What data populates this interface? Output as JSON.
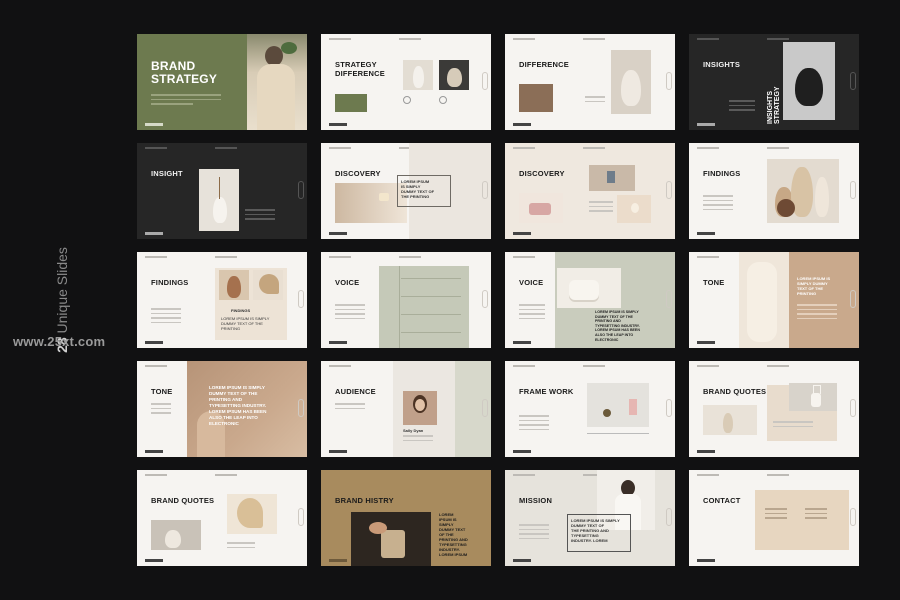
{
  "side": {
    "count": "28",
    "label": "Unique Slides",
    "website": "www.25xt.com"
  },
  "slides": [
    {
      "title": "BRAND\nSTRATEGY"
    },
    {
      "title": "STRATEGY\nDIFFERENCE"
    },
    {
      "title": "DIFFERENCE"
    },
    {
      "title": "INSIGHTS",
      "vertical": "INSIGHTS\nSTRATEGY"
    },
    {
      "title": "INSIGHT"
    },
    {
      "title": "DISCOVERY",
      "caption": "LOREM IPSUM\nIS SIMPLY\nDUMMY TEXT OF\nTHE PRINTING"
    },
    {
      "title": "DISCOVERY"
    },
    {
      "title": "FINDINGS"
    },
    {
      "title": "FINDINGS",
      "caption_title": "FINDINGS",
      "caption": "LOREM IPSUM IS SIMPLY\nDUMMY TEXT OF THE\nPRINTING"
    },
    {
      "title": "VOICE"
    },
    {
      "title": "VOICE",
      "caption": "LOREM IPSUM IS SIMPLY\nDUMMY TEXT OF THE\nPRINTING AND\nTYPESETTING INDUSTRY.\nLOREM IPSUM HAS BEEN\nALSO THE LEAP INTO\nELECTRONIC"
    },
    {
      "title": "TONE",
      "caption": "LOREM IPSUM IS\nSIMPLY DUMMY\nTEXT OF THE\nPRINTING"
    },
    {
      "title": "TONE",
      "caption": "LOREM IPSUM IS SIMPLY\nDUMMY TEXT OF THE\nPRINTING AND\nTYPESETTING INDUSTRY.\nLOREM IPSUM HAS BEEN\nALSO THE LEAP INTO\nELECTRONIC"
    },
    {
      "title": "AUDIENCE",
      "caption": "Sally Dyan"
    },
    {
      "title": "FRAME WORK"
    },
    {
      "title": "BRAND QUOTES"
    },
    {
      "title": "BRAND QUOTES"
    },
    {
      "title": "BRAND HISTRY",
      "caption": "LOREM\nIPSUM IS\nSIMPLY\nDUMMY TEXT\nOF THE\nPRINTING AND\nTYPESETTING\nINDUSTRY.\nLOREM IPSUM"
    },
    {
      "title": "MISSION",
      "caption": "LOREM IPSUM IS SIMPLY\nDUMMY TEXT OF\nTHE PRINTING AND\nTYPESETTING\nINDUSTRY. LOREM"
    },
    {
      "title": "CONTACT"
    }
  ],
  "colors": {
    "background": "#111112",
    "olive": "#6d7a4f",
    "sage": "#c5c9b8",
    "tan": "#a88b5e",
    "clay": "#c9a98c",
    "beige": "#e7dccf"
  }
}
